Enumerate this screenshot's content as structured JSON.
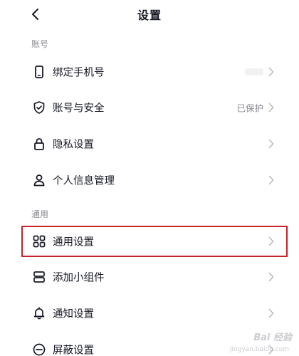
{
  "header": {
    "title": "设置",
    "back_icon": "chevron-left-icon"
  },
  "sections": {
    "account": {
      "label": "账号",
      "items": [
        {
          "label": "绑定手机号",
          "value": "",
          "icon": "phone-icon"
        },
        {
          "label": "账号与安全",
          "value": "已保护",
          "icon": "shield-check-icon"
        },
        {
          "label": "隐私设置",
          "value": "",
          "icon": "lock-icon"
        },
        {
          "label": "个人信息管理",
          "value": "",
          "icon": "person-icon"
        }
      ]
    },
    "general": {
      "label": "通用",
      "items": [
        {
          "label": "通用设置",
          "value": "",
          "icon": "grid-icon"
        },
        {
          "label": "添加小组件",
          "value": "",
          "icon": "widget-icon"
        },
        {
          "label": "通知设置",
          "value": "",
          "icon": "bell-icon"
        },
        {
          "label": "屏蔽设置",
          "value": "",
          "icon": "block-icon"
        }
      ]
    }
  },
  "highlight_color": "#c8212b",
  "text_color": "#161823",
  "secondary_text_color": "#8a8b91",
  "watermark": {
    "text": "Bai 经验",
    "sub": "jingyan.baidu.com"
  }
}
